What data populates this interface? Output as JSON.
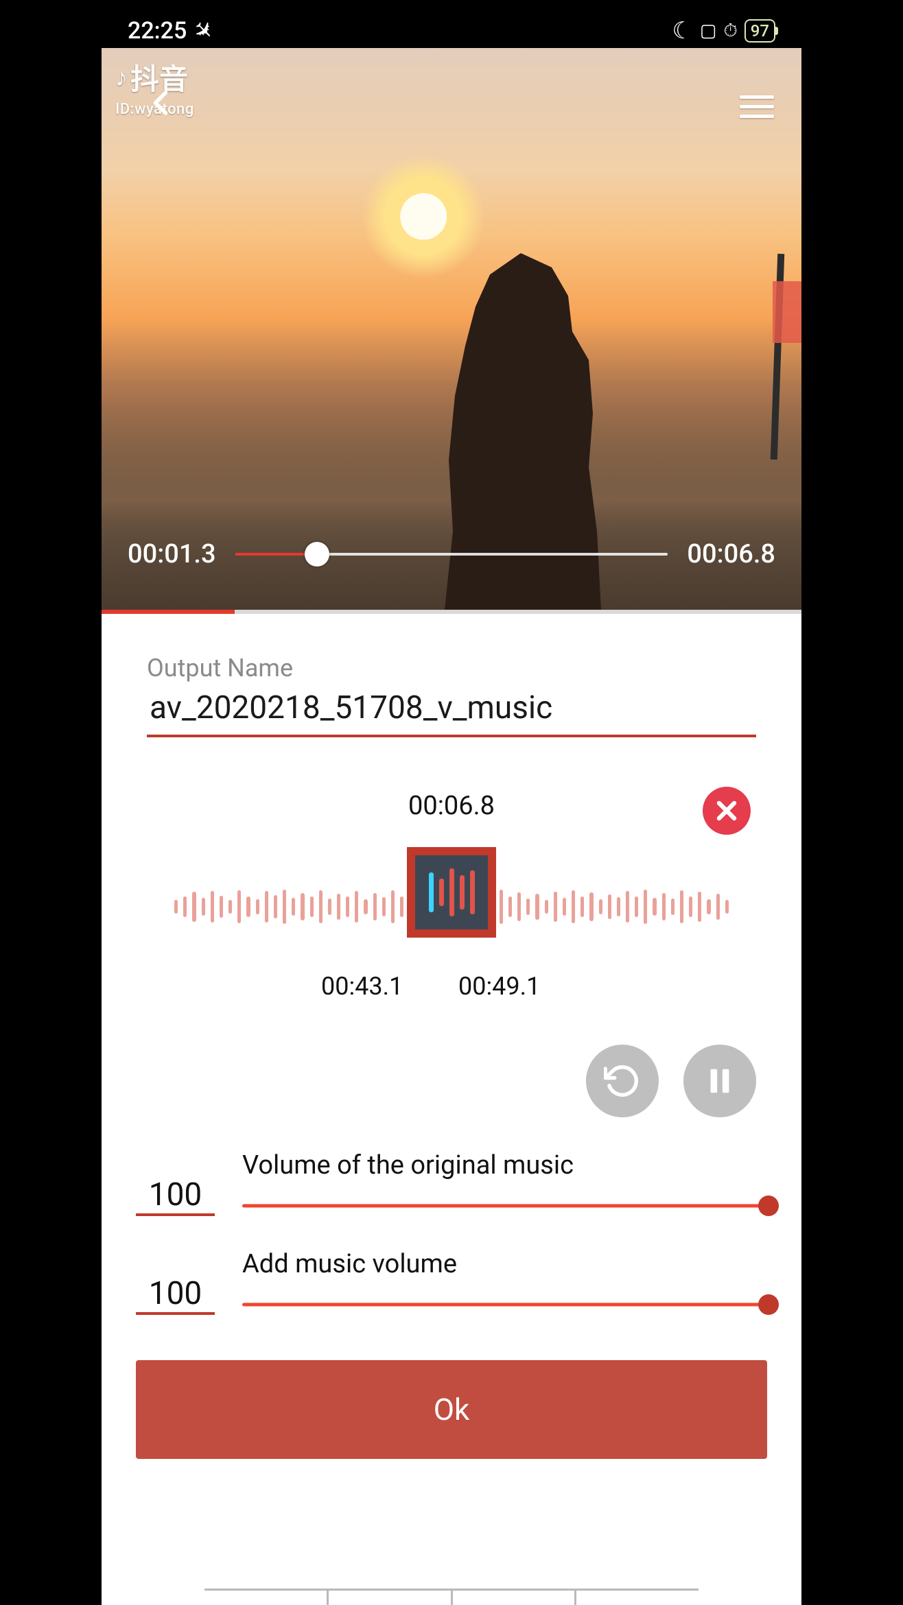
{
  "status_bar": {
    "time": "22:25",
    "airplane_glyph": "✈",
    "moon_glyph": "☾",
    "vibrate_glyph": "📳",
    "alarm_glyph": "⏰",
    "battery": "97"
  },
  "watermark": {
    "app_name": "抖音",
    "note_glyph": "♪",
    "id_label": "ID:wyatong"
  },
  "video": {
    "current": "00:01.3",
    "total": "00:06.8",
    "progress_percent": 19
  },
  "output": {
    "label": "Output Name",
    "value": "av_2020218_51708_v_music"
  },
  "clip": {
    "duration": "00:06.8",
    "start": "00:43.1",
    "end": "00:49.1"
  },
  "volumes": {
    "original_label": "Volume of the original music",
    "original_value": "100",
    "added_label": "Add music volume",
    "added_value": "100"
  },
  "ok_label": "Ok"
}
